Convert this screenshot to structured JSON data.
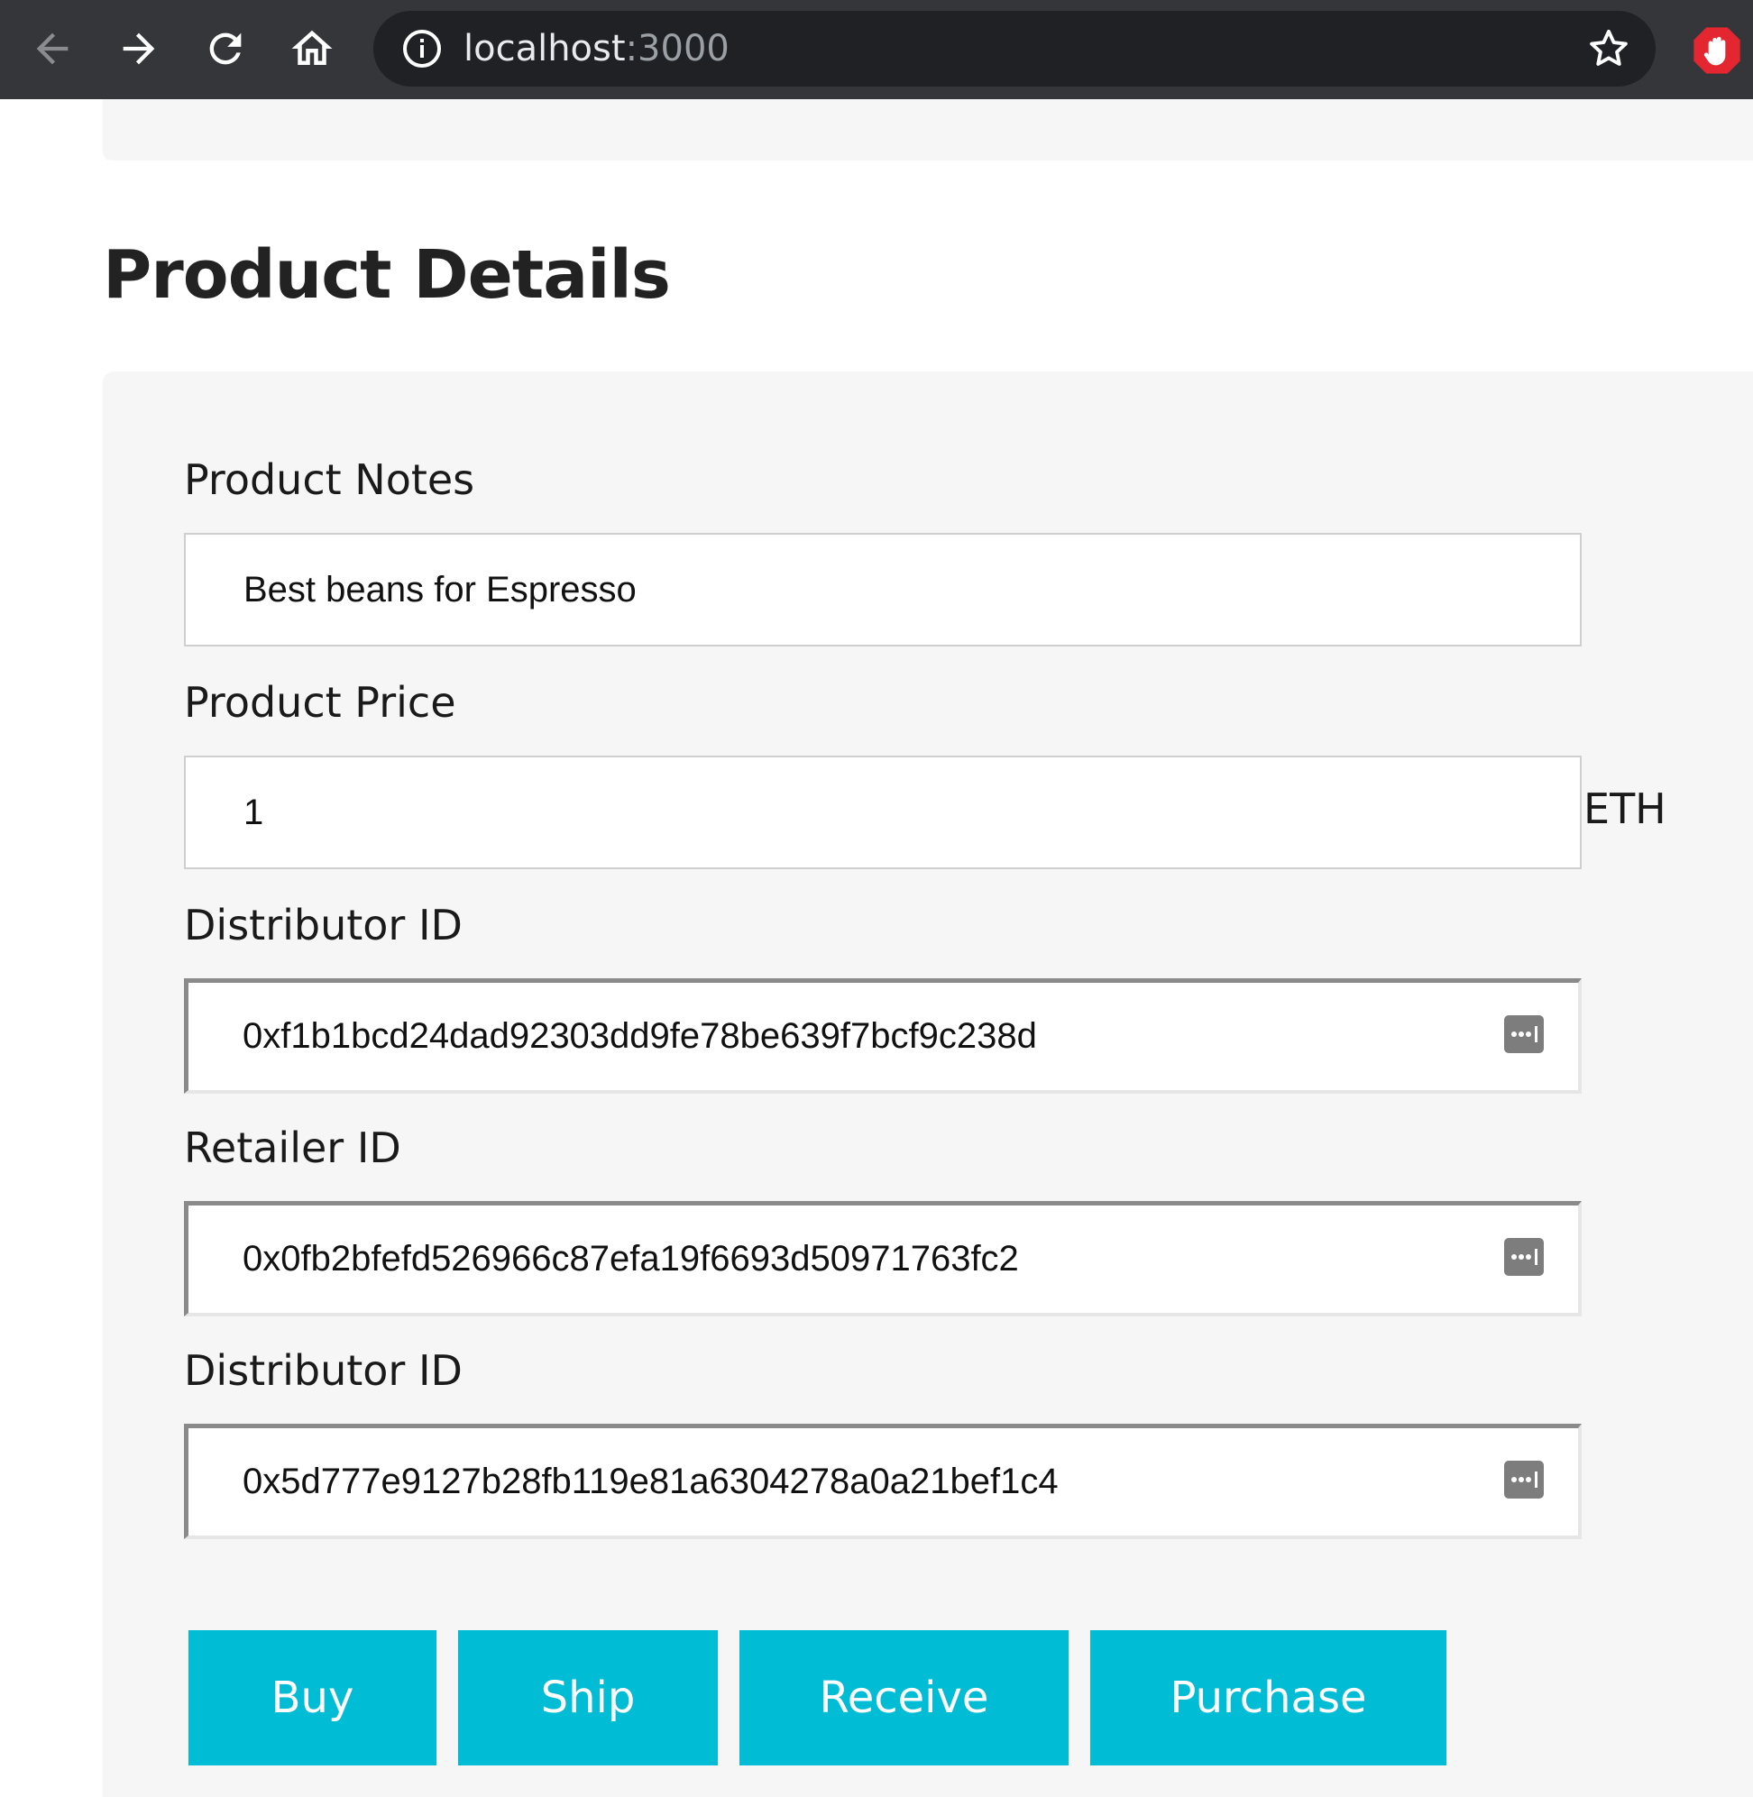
{
  "browser": {
    "url_host": "localhost",
    "url_port": ":3000",
    "icons": [
      "back-arrow-icon",
      "forward-arrow-icon",
      "reload-icon",
      "home-icon",
      "info-icon",
      "star-icon",
      "adblock-hand-icon"
    ]
  },
  "page": {
    "title": "Product Details"
  },
  "form": {
    "notes_label": "Product Notes",
    "notes_value": "Best beans for Espresso",
    "price_label": "Product Price",
    "price_value": "1",
    "price_unit": "ETH",
    "distributor_label": "Distributor ID",
    "distributor_value": "0xf1b1bcd24dad92303dd9fe78be639f7bcf9c238d",
    "retailer_label": "Retailer ID",
    "retailer_value": "0x0fb2bfefd526966c87efa19f6693d50971763fc2",
    "distributor2_label": "Distributor ID",
    "distributor2_value": "0x5d777e9127b28fb119e81a6304278a0a21bef1c4"
  },
  "actions": {
    "buy": "Buy",
    "ship": "Ship",
    "receive": "Receive",
    "purchase": "Purchase"
  },
  "colors": {
    "button": "#00bcd4",
    "panel": "#f6f6f6",
    "browser_bar": "#35363a",
    "omnibox": "#202124"
  }
}
